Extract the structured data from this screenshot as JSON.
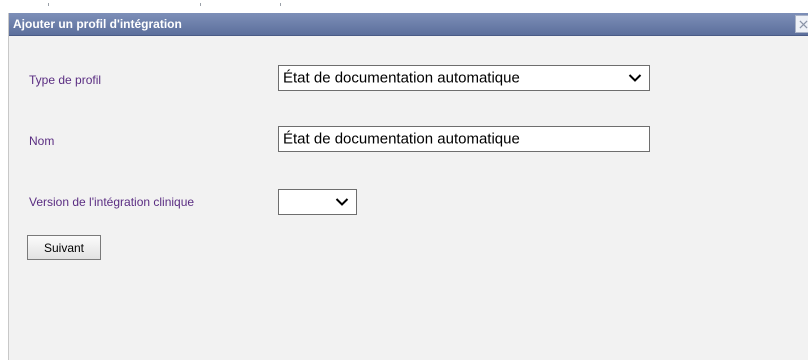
{
  "dialog": {
    "title": "Ajouter un profil d'intégration",
    "close_icon": "close-icon"
  },
  "form": {
    "profile_type": {
      "label": "Type de profil",
      "selected": "État de documentation automatique"
    },
    "name": {
      "label": "Nom",
      "value": "État de documentation automatique"
    },
    "version": {
      "label": "Version de l'intégration clinique",
      "selected": ""
    },
    "next_label": "Suivant"
  },
  "colors": {
    "titlebar": "#5c6f9c",
    "label": "#5a2d82",
    "background": "#f2f2f2"
  }
}
